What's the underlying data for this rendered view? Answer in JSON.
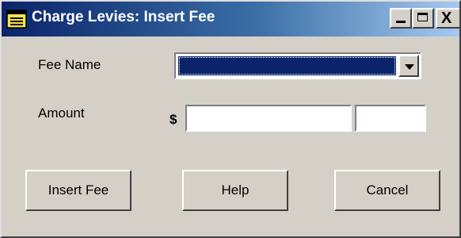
{
  "window": {
    "title": "Charge Levies: Insert Fee",
    "icon": "dialog-window-icon",
    "controls": {
      "minimize": "minimize-icon",
      "maximize": "maximize-icon",
      "close": "close-icon",
      "close_glyph": "X"
    }
  },
  "form": {
    "fee_name_label": "Fee Name",
    "fee_name_value": "",
    "amount_label": "Amount",
    "currency_symbol": "$",
    "amount_dollars_value": "",
    "amount_cents_value": ""
  },
  "buttons": {
    "insert": "Insert Fee",
    "help": "Help",
    "cancel": "Cancel"
  },
  "colors": {
    "dialog_bg": "#d4d0c8",
    "titlebar_start": "#0a246a",
    "titlebar_end": "#a6caf0",
    "selection": "#0a246a"
  }
}
